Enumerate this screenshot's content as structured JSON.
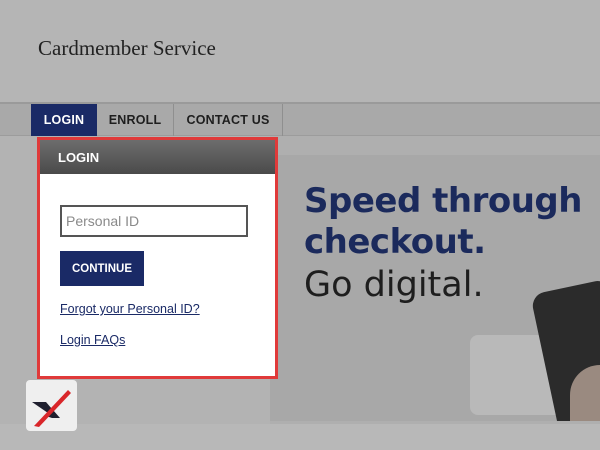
{
  "header": {
    "title": "Cardmember Service"
  },
  "nav": {
    "tabs": [
      {
        "label": "LOGIN",
        "active": true
      },
      {
        "label": "ENROLL",
        "active": false
      },
      {
        "label": "CONTACT US",
        "active": false
      }
    ]
  },
  "login": {
    "heading": "LOGIN",
    "personal_id_placeholder": "Personal ID",
    "continue_label": "CONTINUE",
    "forgot_link": "Forgot your Personal ID?",
    "faq_link": "Login FAQs"
  },
  "banner": {
    "line1": "Speed through",
    "line2": "checkout.",
    "line3": "Go digital."
  },
  "colors": {
    "brand_navy": "#1a2a66",
    "highlight_red": "#e03a3a"
  },
  "icons": {
    "corner_logo": "x-logo-icon"
  }
}
